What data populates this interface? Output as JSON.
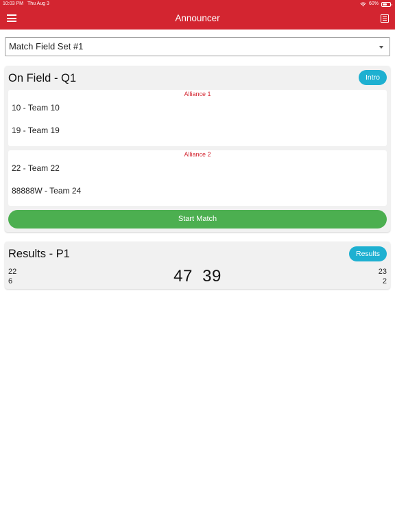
{
  "status_bar": {
    "time": "10:03 PM",
    "date": "Thu Aug 3",
    "battery": "60%",
    "battery_level": 0.6
  },
  "appbar": {
    "title": "Announcer",
    "menu_icon": "hamburger-menu-icon",
    "right_icon": "document-list-icon",
    "color": "#d32530"
  },
  "match_select": {
    "value": "Match Field Set #1"
  },
  "on_field": {
    "title": "On Field - Q1",
    "intro_label": "Intro",
    "alliances": [
      {
        "label": "Alliance 1",
        "teams": [
          "10 - Team 10",
          "19 - Team 19"
        ]
      },
      {
        "label": "Alliance 2",
        "teams": [
          "22 - Team 22",
          "88888W - Team 24"
        ]
      }
    ],
    "start_label": "Start Match"
  },
  "results": {
    "title": "Results - P1",
    "button_label": "Results",
    "left": [
      "22",
      "6"
    ],
    "right": [
      "23",
      "2"
    ],
    "score": "47  39"
  },
  "colors": {
    "accent": "#1eb0d1",
    "start": "#4caf50",
    "alliance_label": "#d32530"
  }
}
